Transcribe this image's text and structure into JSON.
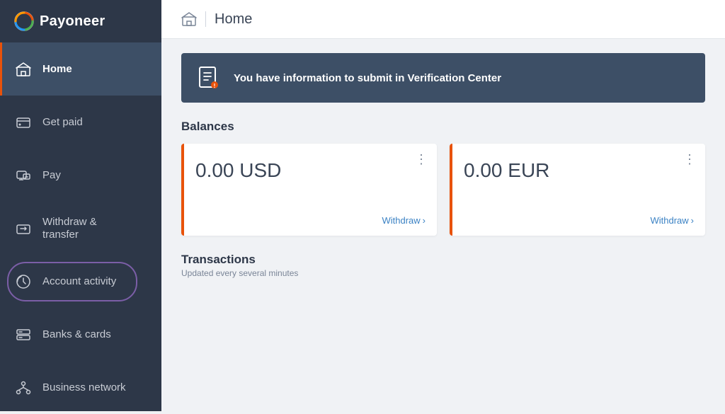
{
  "sidebar": {
    "logo": "Payoneer",
    "items": [
      {
        "id": "home",
        "label": "Home",
        "active": true,
        "annotated": false
      },
      {
        "id": "get-paid",
        "label": "Get paid",
        "active": false,
        "annotated": false
      },
      {
        "id": "pay",
        "label": "Pay",
        "active": false,
        "annotated": false
      },
      {
        "id": "withdraw",
        "label": "Withdraw &\ntransfer",
        "active": false,
        "annotated": false
      },
      {
        "id": "account-activity",
        "label": "Account activity",
        "active": false,
        "annotated": true
      },
      {
        "id": "banks-cards",
        "label": "Banks & cards",
        "active": false,
        "annotated": false
      },
      {
        "id": "business-network",
        "label": "Business network",
        "active": false,
        "annotated": false
      }
    ]
  },
  "header": {
    "title": "Home"
  },
  "banner": {
    "text": "You have information to submit in Verification Center"
  },
  "balances": {
    "section_title": "Balances",
    "cards": [
      {
        "amount": "0.00 USD",
        "withdraw_label": "Withdraw"
      },
      {
        "amount": "0.00 EUR",
        "withdraw_label": "Withdraw"
      }
    ]
  },
  "transactions": {
    "title": "Transactions",
    "subtitle": "Updated every several minutes"
  }
}
